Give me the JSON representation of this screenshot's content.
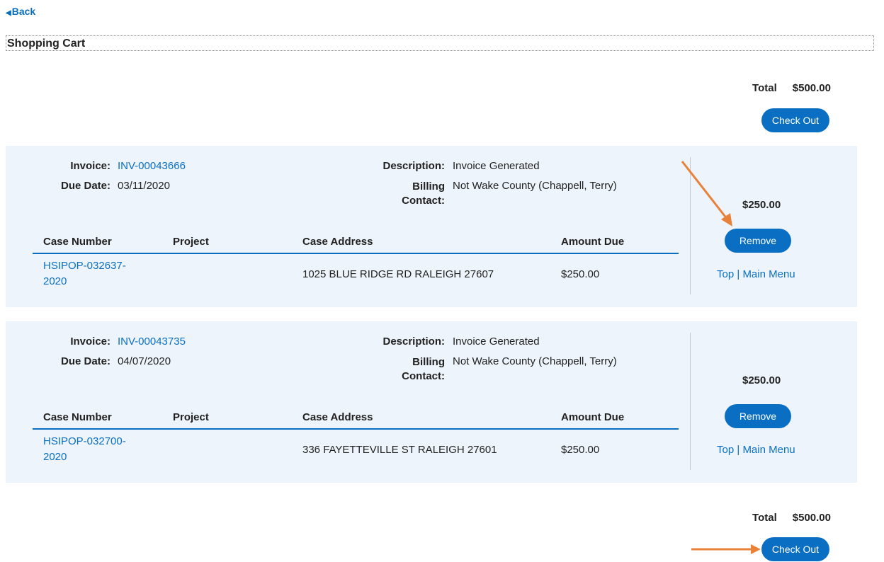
{
  "nav": {
    "back_label": "Back",
    "back_icon": "triangle-left-icon"
  },
  "page": {
    "title": "Shopping Cart"
  },
  "summary": {
    "total_label": "Total",
    "total_value": "$500.00",
    "checkout_label": "Check Out"
  },
  "labels": {
    "invoice": "Invoice:",
    "due_date": "Due Date:",
    "description": "Description:",
    "billing_contact": "Billing Contact:",
    "case_number": "Case Number",
    "project": "Project",
    "case_address": "Case Address",
    "amount_due": "Amount Due",
    "remove": "Remove",
    "top": "Top",
    "separator": "|",
    "main_menu": "Main Menu"
  },
  "invoices": [
    {
      "invoice": "INV-00043666",
      "due_date": "03/11/2020",
      "description": "Invoice Generated",
      "billing_contact": "Not Wake County (Chappell, Terry)",
      "amount": "$250.00",
      "case_line1": "HSIPOP-032637-",
      "case_line2": "2020",
      "project": "",
      "address": "1025 BLUE RIDGE RD RALEIGH 27607",
      "amount_due": "$250.00"
    },
    {
      "invoice": "INV-00043735",
      "due_date": "04/07/2020",
      "description": "Invoice Generated",
      "billing_contact": "Not Wake County (Chappell, Terry)",
      "amount": "$250.00",
      "case_line1": "HSIPOP-032700-",
      "case_line2": "2020",
      "project": "",
      "address": "336 FAYETTEVILLE ST RALEIGH 27601",
      "amount_due": "$250.00"
    }
  ],
  "annotations": {
    "arrow_color": "#e8823a"
  },
  "colors": {
    "link": "#0a6fc2",
    "card_bg": "#edf4fb",
    "button": "#0a6fc2"
  }
}
